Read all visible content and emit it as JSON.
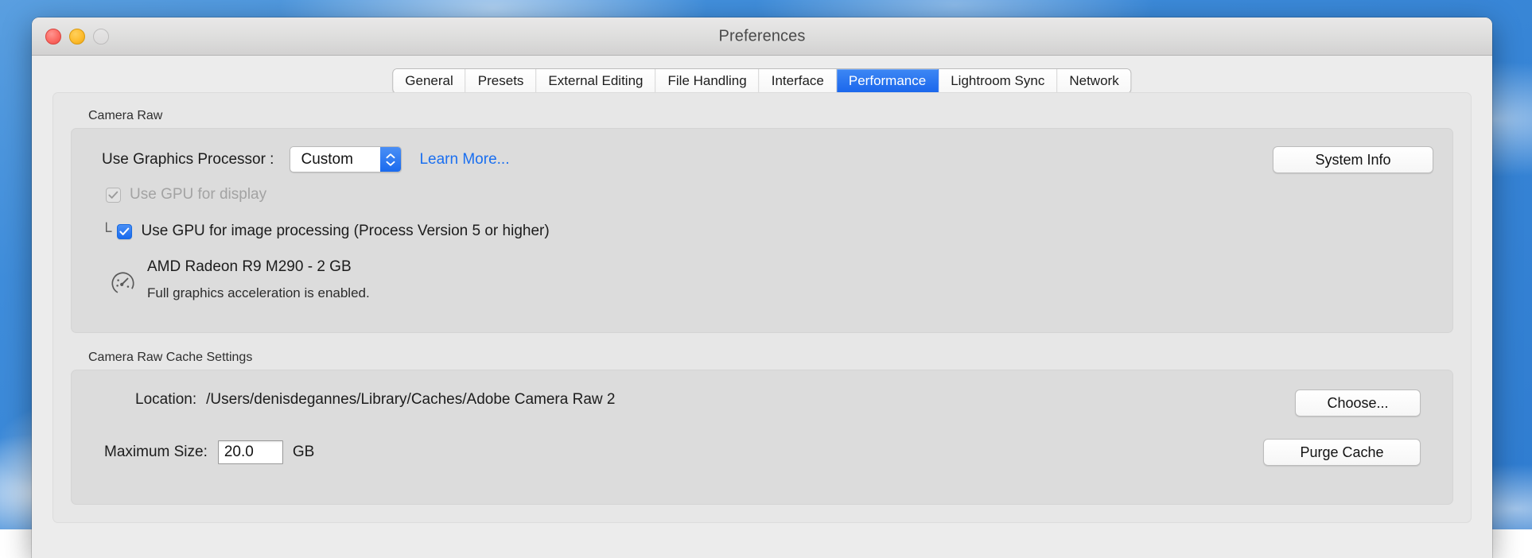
{
  "desktop": {
    "wallpaper": "blue-sky-clouds"
  },
  "window": {
    "title": "Preferences",
    "traffic_lights": {
      "close_label": "close",
      "minimize_label": "minimize",
      "zoom_label": "zoom"
    }
  },
  "tabs": [
    {
      "label": "General",
      "selected": false
    },
    {
      "label": "Presets",
      "selected": false
    },
    {
      "label": "External Editing",
      "selected": false
    },
    {
      "label": "File Handling",
      "selected": false
    },
    {
      "label": "Interface",
      "selected": false
    },
    {
      "label": "Performance",
      "selected": true
    },
    {
      "label": "Lightroom Sync",
      "selected": false
    },
    {
      "label": "Network",
      "selected": false
    }
  ],
  "camera_raw": {
    "group_label": "Camera Raw",
    "graphics_processor_label": "Use Graphics Processor :",
    "graphics_processor_value": "Custom",
    "graphics_processor_options": [
      "Custom"
    ],
    "learn_more_label": "Learn More...",
    "system_info_button": "System Info",
    "use_gpu_display": {
      "label": "Use GPU for display",
      "checked": true,
      "enabled": false
    },
    "use_gpu_processing": {
      "elbow": "└",
      "label": "Use GPU for image processing (Process Version 5 or higher)",
      "checked": true,
      "enabled": true
    },
    "gpu_icon": "gauge-icon",
    "gpu_name": "AMD Radeon R9 M290 - 2 GB",
    "gpu_status": "Full graphics acceleration is enabled."
  },
  "cache": {
    "group_label": "Camera Raw Cache Settings",
    "location_label": "Location:",
    "location_value": "/Users/denisdegannes/Library/Caches/Adobe Camera Raw 2",
    "choose_button": "Choose...",
    "max_size_label": "Maximum Size:",
    "max_size_value": "20.0",
    "max_size_unit": "GB",
    "purge_button": "Purge Cache"
  },
  "colors": {
    "accent_blue": "#1a66ec",
    "link_blue": "#1a6ff0",
    "window_bg": "#ececec",
    "panel_bg": "#e7e7e7",
    "group_bg": "#dcdcdc"
  }
}
